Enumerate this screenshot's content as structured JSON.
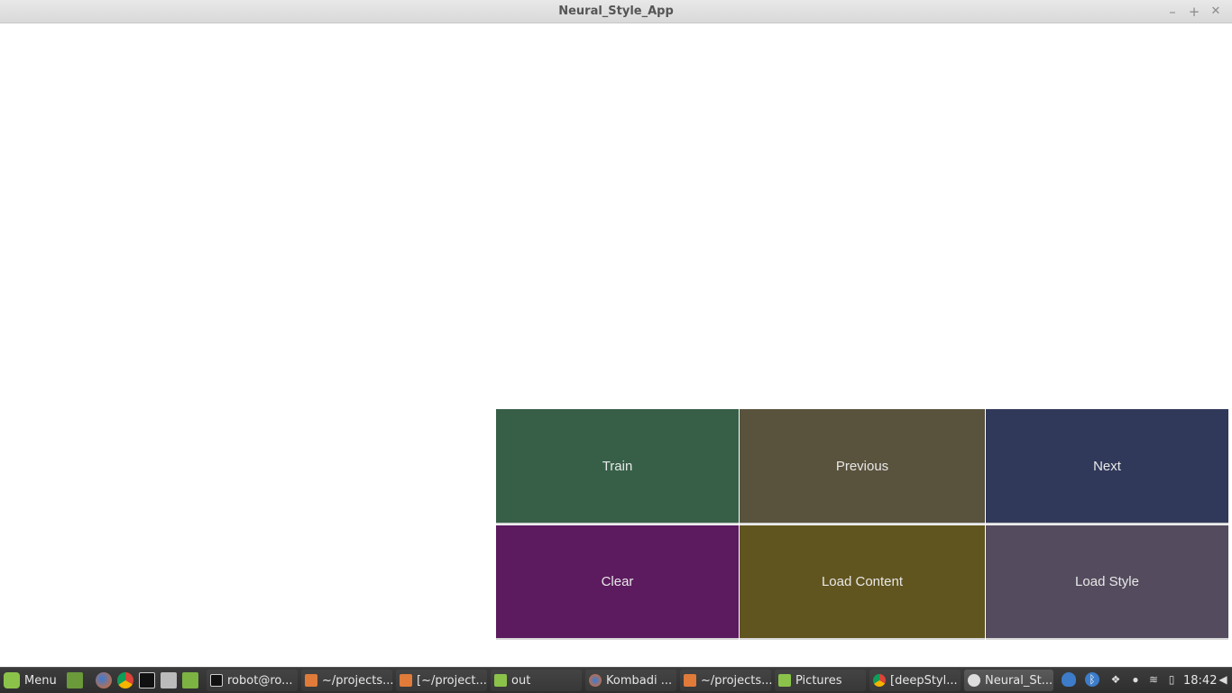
{
  "window": {
    "title": "Neural_Style_App",
    "controls": {
      "minimize": "–",
      "maximize": "+",
      "close": "✕"
    }
  },
  "buttons": [
    {
      "label": "Train",
      "color": "#375F48"
    },
    {
      "label": "Previous",
      "color": "#59523D"
    },
    {
      "label": "Next",
      "color": "#31395A"
    },
    {
      "label": "Clear",
      "color": "#5C1B5E"
    },
    {
      "label": "Load Content",
      "color": "#61551F"
    },
    {
      "label": "Load Style",
      "color": "#544C5E"
    }
  ],
  "taskbar": {
    "menu_label": "Menu",
    "launchers": [
      "show-desktop-icon",
      "firefox-icon",
      "chrome-icon",
      "terminal-icon",
      "camera-icon",
      "files-icon"
    ],
    "windows": [
      {
        "label": "robot@ro...",
        "icon": "terminal-icon"
      },
      {
        "label": "~/projects...",
        "icon": "sublime-icon"
      },
      {
        "label": "[~/project...",
        "icon": "sublime-icon"
      },
      {
        "label": "out",
        "icon": "folder-icon"
      },
      {
        "label": "Kombadi ...",
        "icon": "firefox-icon"
      },
      {
        "label": "~/projects...",
        "icon": "sublime-icon"
      },
      {
        "label": "Pictures",
        "icon": "folder-icon"
      },
      {
        "label": "[deepStyl...",
        "icon": "chrome-icon"
      },
      {
        "label": "Neural_St...",
        "icon": "app-icon"
      }
    ],
    "tray": [
      "shield-icon",
      "bluetooth-icon",
      "dropbox-icon",
      "user-icon",
      "wifi-icon",
      "battery-icon"
    ],
    "clock": "18:42"
  }
}
